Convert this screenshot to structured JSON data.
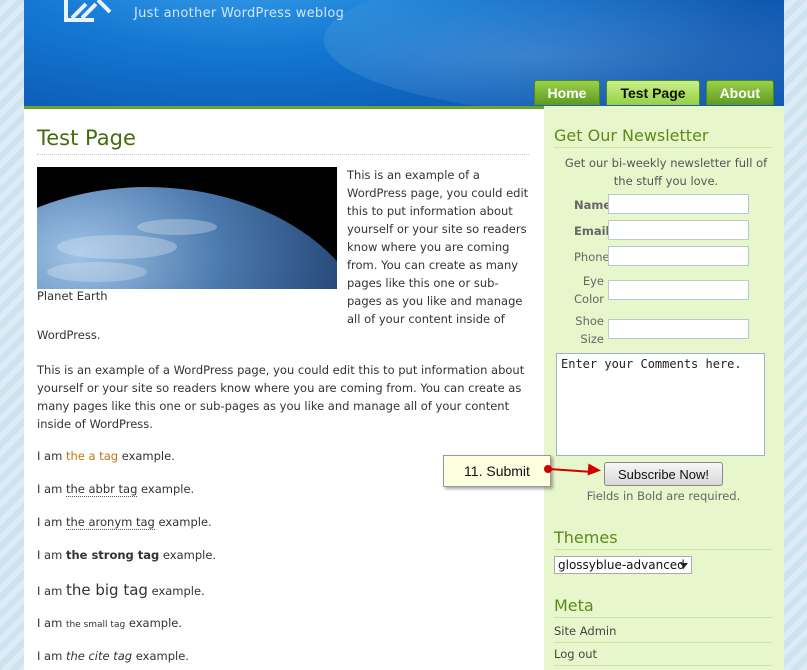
{
  "header": {
    "tagline": "Just another WordPress weblog",
    "nav": [
      "Home",
      "Test Page",
      "About"
    ],
    "active_tab": "Test Page"
  },
  "main": {
    "title": "Test Page",
    "image_caption": "Planet Earth",
    "para1": "This is an example of a WordPress page, you could edit this to put information about yourself or your site so readers know where you are coming from. You can create as many pages like this one or sub-pages as you like and manage all of your content inside of",
    "para1_end": "WordPress.",
    "para2": "This is an example of a WordPress page, you could edit this to put information about yourself or your site so readers know where you are coming from. You can create as many pages like this one or sub-pages as you like and manage all of your content inside of WordPress.",
    "examples": [
      {
        "pre": "I am ",
        "tag": "the a tag",
        "post": " example."
      },
      {
        "pre": "I am ",
        "tag": "the abbr tag",
        "post": " example."
      },
      {
        "pre": "I am ",
        "tag": "the aronym tag",
        "post": " example."
      },
      {
        "pre": "I am ",
        "tag": "the strong tag",
        "post": " example."
      },
      {
        "pre": "I am ",
        "tag": "the big tag",
        "post": " example."
      },
      {
        "pre": "I am ",
        "tag": "the small tag",
        "post": " example."
      },
      {
        "pre": "I am ",
        "tag": "the cite tag",
        "post": " example."
      }
    ]
  },
  "sidebar": {
    "newsletter_title": "Get Our Newsletter",
    "newsletter_desc": "Get our bi-weekly newsletter full of the stuff you love.",
    "fields": {
      "name": "Name",
      "email": "Email",
      "phone": "Phone",
      "eye_color_1": "Eye",
      "eye_color_2": "Color",
      "shoe_size_1": "Shoe",
      "shoe_size_2": "Size"
    },
    "comments_placeholder": "Enter your Comments here.",
    "subscribe_label": "Subscribe Now!",
    "required_note": "Fields in Bold are required.",
    "themes_title": "Themes",
    "theme_selected": "glossyblue-advanced",
    "meta_title": "Meta",
    "meta_links": [
      "Site Admin",
      "Log out"
    ]
  },
  "callout": {
    "label": "11. Submit"
  }
}
